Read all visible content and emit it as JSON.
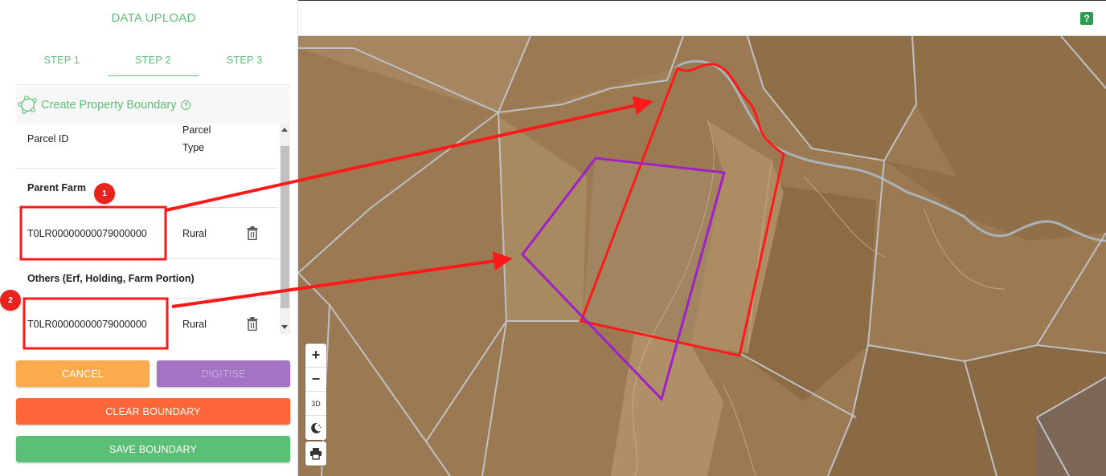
{
  "panel": {
    "title": "DATA UPLOAD",
    "steps": [
      {
        "label": "STEP 1"
      },
      {
        "label": "STEP 2"
      },
      {
        "label": "STEP 3"
      }
    ],
    "active_step": 1,
    "section_title": "Create Property Boundary",
    "help_glyph": "?"
  },
  "table": {
    "headers": {
      "parcel_id": "Parcel ID",
      "parcel_type_line1": "Parcel",
      "parcel_type_line2": "Type"
    },
    "groups": [
      {
        "title": "Parent Farm",
        "rows": [
          {
            "parcel_id": "T0LR00000000079000000",
            "parcel_type": "Rural"
          }
        ]
      },
      {
        "title": "Others (Erf, Holding, Farm Portion)",
        "rows": [
          {
            "parcel_id": "T0LR00000000079000000",
            "parcel_type": "Rural"
          }
        ]
      }
    ]
  },
  "buttons": {
    "cancel": "CANCEL",
    "digitise": "DIGITISE",
    "clear_boundary": "CLEAR BOUNDARY",
    "save_boundary": "SAVE BOUNDARY"
  },
  "topbar": {
    "help_label": "?"
  },
  "map_controls": {
    "zoom_in": "+",
    "zoom_out": "−",
    "toggle_3d": "3D"
  },
  "annotations": {
    "badge_1": "1",
    "badge_2": "2"
  },
  "colors": {
    "accent_green": "#5cbf76",
    "cancel": "#fbab4b",
    "digitise": "#a374c4",
    "clear": "#fe6639",
    "save": "#5cbf76",
    "boundary_red": "#ff1a1a",
    "boundary_purple": "#a020c8"
  },
  "icons": [
    "polygon-icon",
    "help-circle-icon",
    "trash-icon",
    "compass-3d-icon",
    "moon-icon",
    "print-icon",
    "help-square-icon"
  ]
}
